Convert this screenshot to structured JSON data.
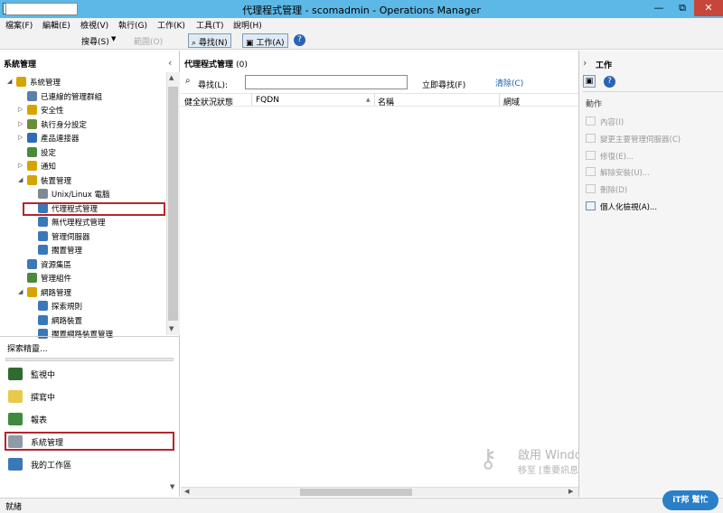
{
  "window": {
    "title": "代理程式管理 - scomadmin - Operations Manager",
    "minimize": "—",
    "maximize": "⧉",
    "close": "✕"
  },
  "menu": [
    "檔案(F)",
    "編輯(E)",
    "檢視(V)",
    "執行(G)",
    "工作(K)",
    "工具(T)",
    "說明(H)"
  ],
  "toolbar": {
    "search_label": "搜尋(S)",
    "scope_label": "範圍(O)",
    "find_label": "尋找(N)",
    "tasks_label": "工作(A)"
  },
  "left": {
    "header": "系統管理",
    "collapse": "‹",
    "tree": [
      {
        "label": "系統管理",
        "indent": 0,
        "arrow": "◢",
        "color": "#d6a400"
      },
      {
        "label": "已連線的管理群組",
        "indent": 1,
        "arrow": "",
        "color": "#5b7fa8"
      },
      {
        "label": "安全性",
        "indent": 1,
        "arrow": "▷",
        "color": "#d6a400"
      },
      {
        "label": "執行身分設定",
        "indent": 1,
        "arrow": "▷",
        "color": "#6b8e3a"
      },
      {
        "label": "產品連接器",
        "indent": 1,
        "arrow": "▷",
        "color": "#2e6db5"
      },
      {
        "label": "設定",
        "indent": 1,
        "arrow": "",
        "color": "#4a8a3a"
      },
      {
        "label": "通知",
        "indent": 1,
        "arrow": "▷",
        "color": "#d6a400"
      },
      {
        "label": "裝置管理",
        "indent": 1,
        "arrow": "◢",
        "color": "#d6a400"
      },
      {
        "label": "Unix/Linux 電腦",
        "indent": 2,
        "arrow": "",
        "color": "#7d8a96"
      },
      {
        "label": "代理程式管理",
        "indent": 2,
        "arrow": "",
        "color": "#3a78b8"
      },
      {
        "label": "無代理程式管理",
        "indent": 2,
        "arrow": "",
        "color": "#3a78b8"
      },
      {
        "label": "管理伺服器",
        "indent": 2,
        "arrow": "",
        "color": "#3a78b8"
      },
      {
        "label": "擱置管理",
        "indent": 2,
        "arrow": "",
        "color": "#3a78b8"
      },
      {
        "label": "資源集區",
        "indent": 1,
        "arrow": "",
        "color": "#3a78b8"
      },
      {
        "label": "管理組件",
        "indent": 1,
        "arrow": "",
        "color": "#4a8a3a"
      },
      {
        "label": "網路管理",
        "indent": 1,
        "arrow": "◢",
        "color": "#d6a400"
      },
      {
        "label": "探索規則",
        "indent": 2,
        "arrow": "",
        "color": "#3a78b8"
      },
      {
        "label": "網路裝置",
        "indent": 2,
        "arrow": "",
        "color": "#3a78b8"
      },
      {
        "label": "擱置網路裝置管理",
        "indent": 2,
        "arrow": "",
        "color": "#3a78b8"
      }
    ],
    "discovery_link": "探索精靈...",
    "wunderbar": [
      {
        "label": "監視中",
        "color": "#2f6b2f"
      },
      {
        "label": "撰寫中",
        "color": "#e8c94a"
      },
      {
        "label": "報表",
        "color": "#3f8a3f"
      },
      {
        "label": "系統管理",
        "color": "#8e9aa5"
      },
      {
        "label": "我的工作區",
        "color": "#3a78b8"
      }
    ]
  },
  "center": {
    "title": "代理程式管理",
    "count": "(0)",
    "find_label": "尋找(L):",
    "find_value": "",
    "find_now": "立即尋找(F)",
    "clear": "清除(C)",
    "columns": [
      "健全狀況狀態",
      "FQDN",
      "名稱",
      "網域"
    ]
  },
  "right": {
    "collapse": "›",
    "header": "工作",
    "section": "動作",
    "actions": [
      {
        "label": "內容(I)",
        "enabled": false
      },
      {
        "label": "變更主要管理伺服器(C)",
        "enabled": false
      },
      {
        "label": "修復(E)...",
        "enabled": false
      },
      {
        "label": "解除安裝(U)...",
        "enabled": false
      },
      {
        "label": "刪除(D)",
        "enabled": false
      },
      {
        "label": "個人化檢視(A)...",
        "enabled": true
      }
    ]
  },
  "watermark": {
    "line1": "啟用 Windows",
    "line2": "移至 [重要訊息中心] 以啟用 Windows"
  },
  "status": "就緒",
  "badge": {
    "line1": "iT邦",
    "line2": "幫忙"
  }
}
